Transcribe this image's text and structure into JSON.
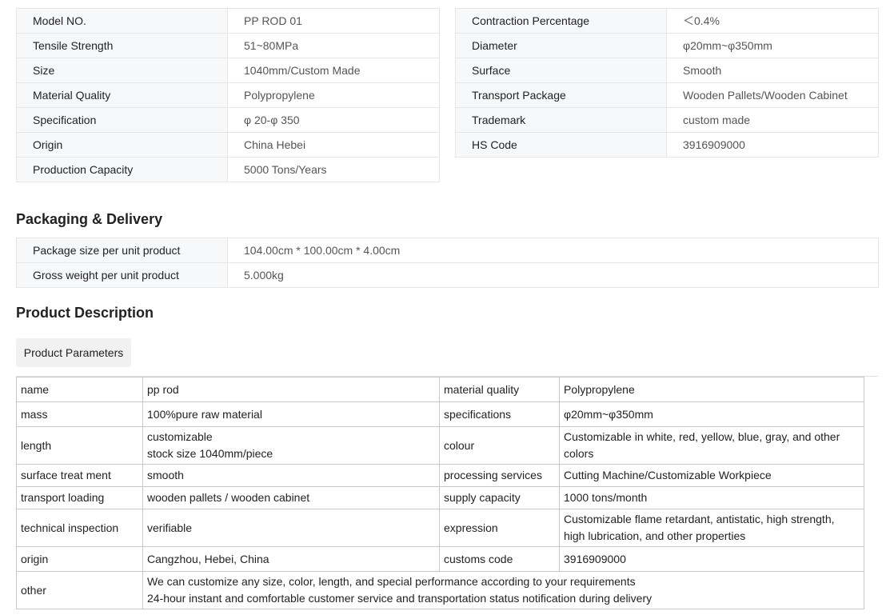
{
  "specs_left": [
    {
      "key": "Model NO.",
      "value": "PP ROD 01"
    },
    {
      "key": "Tensile Strength",
      "value": "51~80MPa"
    },
    {
      "key": "Size",
      "value": "1040mm/Custom Made"
    },
    {
      "key": "Material Quality",
      "value": "Polypropylene"
    },
    {
      "key": "Specification",
      "value": "φ 20-φ 350"
    },
    {
      "key": "Origin",
      "value": "China Hebei"
    },
    {
      "key": "Production Capacity",
      "value": "5000 Tons/Years"
    }
  ],
  "specs_right": [
    {
      "key": "Contraction Percentage",
      "value": "＜0.4%"
    },
    {
      "key": "Diameter",
      "value": "φ20mm~φ350mm"
    },
    {
      "key": "Surface",
      "value": "Smooth"
    },
    {
      "key": "Transport Package",
      "value": "Wooden Pallets/Wooden Cabinet"
    },
    {
      "key": "Trademark",
      "value": "custom made"
    },
    {
      "key": "HS Code",
      "value": "3916909000"
    }
  ],
  "packaging": {
    "title": "Packaging & Delivery",
    "rows": [
      {
        "key": "Package size per unit product",
        "value": "104.00cm * 100.00cm * 4.00cm"
      },
      {
        "key": "Gross weight per unit product",
        "value": "5.000kg"
      }
    ]
  },
  "description": {
    "title": "Product Description",
    "tab_label": "Product Parameters",
    "rows": [
      {
        "k1": "name",
        "v1": [
          "pp rod"
        ],
        "k2": "material quality",
        "v2": [
          "Polypropylene"
        ]
      },
      {
        "k1": "mass",
        "v1": [
          "100%pure raw material"
        ],
        "k2": "specifications",
        "v2": [
          "φ20mm~φ350mm"
        ]
      },
      {
        "k1": "length",
        "v1": [
          "customizable",
          "stock size 1040mm/piece"
        ],
        "k2": "colour",
        "v2": [
          "Customizable in white, red, yellow, blue, gray, and other",
          "colors"
        ]
      },
      {
        "k1": "surface treat ment",
        "v1": [
          "smooth"
        ],
        "k2": "processing services",
        "v2": [
          "Cutting Machine/Customizable Workpiece"
        ]
      },
      {
        "k1": "transport loading",
        "v1": [
          "wooden pallets / wooden cabinet"
        ],
        "k2": "supply capacity",
        "v2": [
          "1000 tons/month"
        ]
      },
      {
        "k1": "technical inspection",
        "v1": [
          "verifiable"
        ],
        "k2": "expression",
        "v2": [
          "Customizable flame retardant, antistatic, high strength,",
          "high lubrication, and other properties"
        ]
      },
      {
        "k1": "origin",
        "v1": [
          "Cangzhou, Hebei, China"
        ],
        "k2": "customs code",
        "v2": [
          "3916909000"
        ]
      }
    ],
    "other": {
      "key": "other",
      "lines": [
        "We can customize any size, color, length, and special performance according to your requirements",
        "24-hour instant and comfortable customer service and transportation status notification during delivery"
      ]
    }
  }
}
